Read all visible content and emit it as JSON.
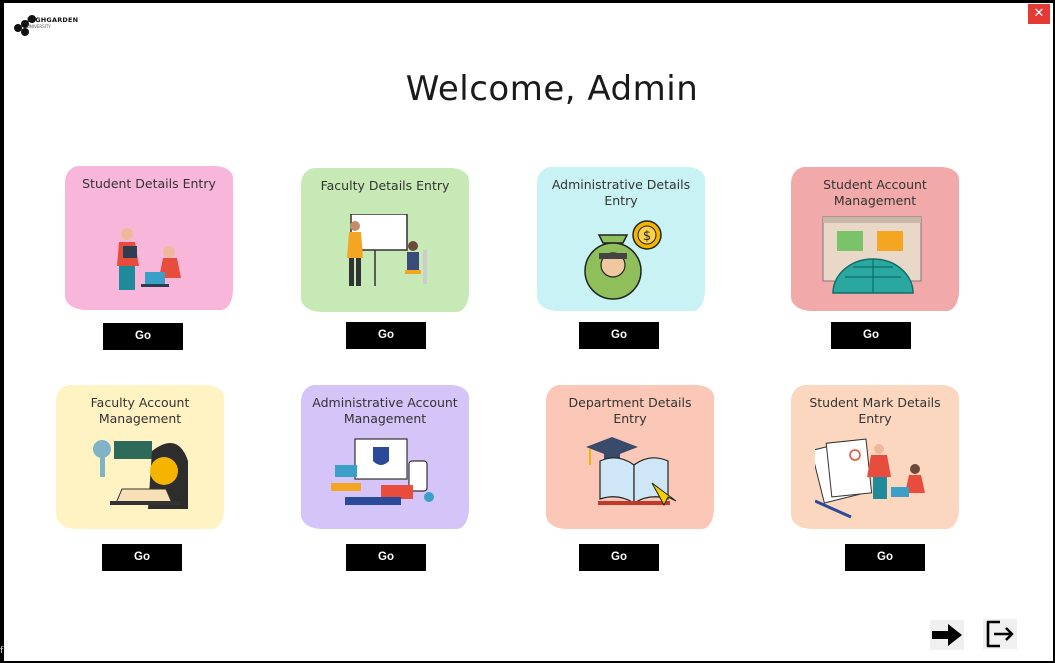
{
  "window": {
    "close_glyph": "✕"
  },
  "logo": {
    "name": "HIGHGARDEN",
    "sub": "UNIVERSITY"
  },
  "header": {
    "title": "Welcome, Admin"
  },
  "cards": [
    {
      "title": "Student Details Entry",
      "button": "Go",
      "bg": "#f7b6da",
      "icon": "students-icon"
    },
    {
      "title": "Faculty Details Entry",
      "button": "Go",
      "bg": "#c7e9b5",
      "icon": "teacher-board-icon"
    },
    {
      "title": "Administrative Details Entry",
      "button": "Go",
      "bg": "#c8f2f4",
      "icon": "money-bag-icon"
    },
    {
      "title": "Student Account Management",
      "button": "Go",
      "bg": "#f1a9a9",
      "icon": "globe-dashboard-icon"
    },
    {
      "title": "Faculty Account Management",
      "button": "Go",
      "bg": "#fff3c3",
      "icon": "key-login-icon"
    },
    {
      "title": "Administrative Account Management",
      "button": "Go",
      "bg": "#d4c4f7",
      "icon": "security-devices-icon"
    },
    {
      "title": "Department Details Entry",
      "button": "Go",
      "bg": "#fbc7b6",
      "icon": "graduation-book-icon"
    },
    {
      "title": "Student Mark Details Entry",
      "button": "Go",
      "bg": "#fcd7bf",
      "icon": "marksheet-icon"
    }
  ],
  "footer": {
    "next_icon": "arrow-right-icon",
    "logout_icon": "logout-icon"
  },
  "edge": {
    "glyph": "f"
  }
}
